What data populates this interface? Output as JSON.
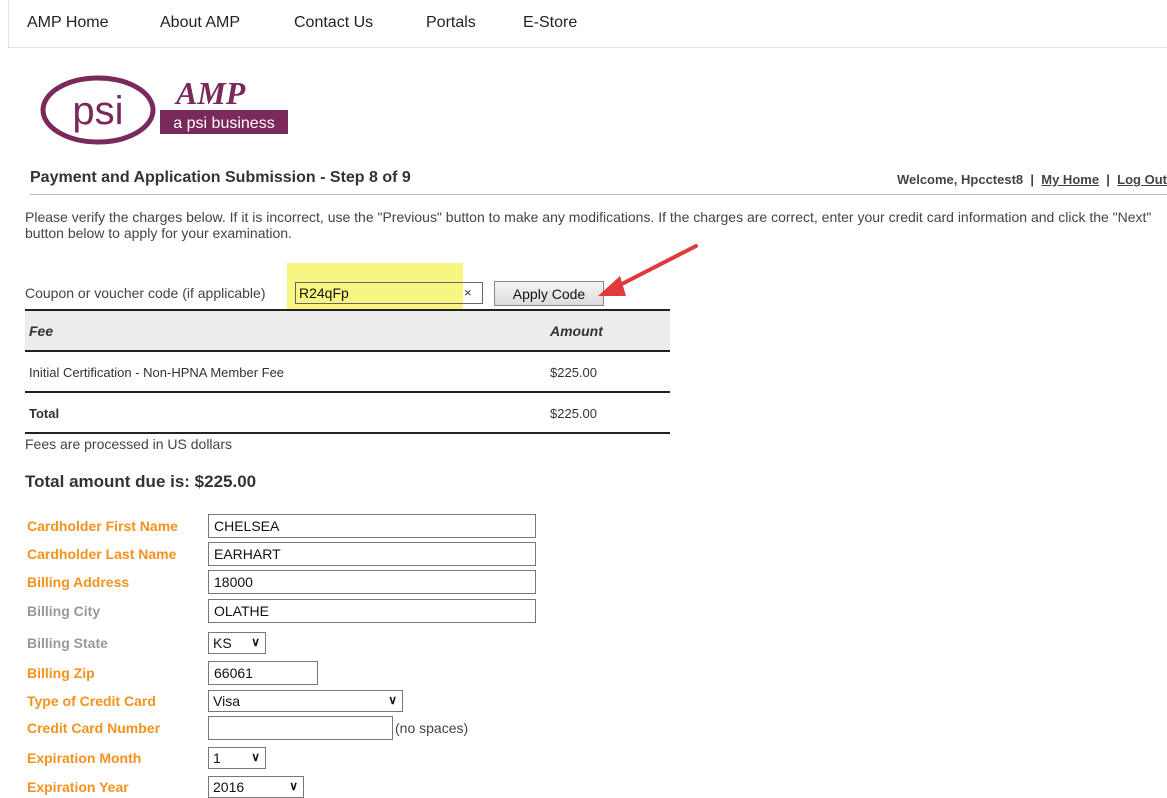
{
  "nav": {
    "items": [
      "AMP Home",
      "About AMP",
      "Contact Us",
      "Portals",
      "E-Store"
    ]
  },
  "logo": {
    "psi_text": "psi",
    "amp_text": "AMP",
    "tagline": "a psi business"
  },
  "header": {
    "title": "Payment and Application Submission - Step 8 of 9",
    "welcome": "Welcome, Hpcctest8",
    "sep": "|",
    "my_home": "My Home",
    "log_out": "Log Out"
  },
  "instructions": "Please verify the charges below. If it is incorrect, use the \"Previous\" button to make any modifications. If the charges are correct, enter your credit card information and click the \"Next\" button below to apply for your examination.",
  "coupon": {
    "label": "Coupon or voucher code (if applicable)",
    "value": "R24qFp",
    "clear": "×",
    "apply_label": "Apply Code"
  },
  "fees": {
    "headers": [
      "Fee",
      "Amount"
    ],
    "rows": [
      {
        "fee": "Initial Certification - Non-HPNA Member Fee",
        "amount": "$225.00"
      }
    ],
    "total_label": "Total",
    "total_amount": "$225.00",
    "note": "Fees are processed in US dollars"
  },
  "total_due": "Total amount due is: $225.00",
  "form": {
    "first_name": {
      "label": "Cardholder First Name",
      "value": "CHELSEA"
    },
    "last_name": {
      "label": "Cardholder Last Name",
      "value": "EARHART"
    },
    "address": {
      "label": "Billing Address",
      "value": "18000"
    },
    "city": {
      "label": "Billing City",
      "value": "OLATHE"
    },
    "state": {
      "label": "Billing State",
      "value": "KS"
    },
    "zip": {
      "label": "Billing Zip",
      "value": "66061"
    },
    "card_type": {
      "label": "Type of Credit Card",
      "value": "Visa"
    },
    "card_number": {
      "label": "Credit Card Number",
      "value": "",
      "hint": "(no spaces)"
    },
    "exp_month": {
      "label": "Expiration Month",
      "value": "1"
    },
    "exp_year": {
      "label": "Expiration Year",
      "value": "2016"
    }
  },
  "colors": {
    "required_label": "#f5921e",
    "optional_label": "#999999",
    "logo_purple": "#7a2a5a",
    "highlight": "#f7f46c",
    "arrow": "#e03a3a"
  }
}
